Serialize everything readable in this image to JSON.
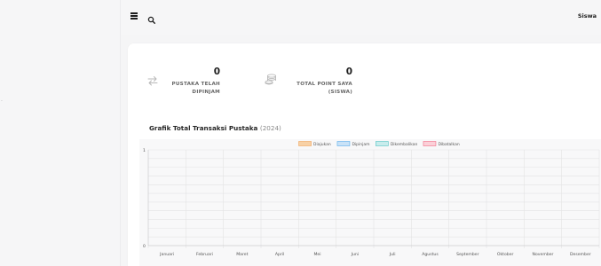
{
  "topbar": {
    "user_name": "Siswa"
  },
  "stats": [
    {
      "value": "0",
      "label_lines": [
        "PUSTAKA TELAH",
        "DIPINJAM"
      ],
      "icon": "swap-arrows-icon"
    },
    {
      "value": "0",
      "label_lines": [
        "TOTAL POINT SAYA",
        "(SISWA)"
      ],
      "icon": "coins-stack-icon"
    }
  ],
  "chart": {
    "title": "Grafik Total Transaksi Pustaka",
    "year": "(2024)"
  },
  "chart_data": {
    "type": "bar",
    "categories": [
      "Januari",
      "Februari",
      "Maret",
      "April",
      "Mei",
      "Juni",
      "Juli",
      "Agustus",
      "September",
      "Oktober",
      "November",
      "Desember"
    ],
    "series": [
      {
        "name": "Diajukan",
        "color": "#f7d1a6",
        "border": "#f0a35a",
        "values": [
          0,
          0,
          0,
          0,
          0,
          0,
          0,
          0,
          0,
          0,
          0,
          0
        ]
      },
      {
        "name": "Dipinjam",
        "color": "#c9e2f7",
        "border": "#5aaeea",
        "values": [
          0,
          0,
          0,
          0,
          0,
          0,
          0,
          0,
          0,
          0,
          0,
          0
        ]
      },
      {
        "name": "Dikembalikan",
        "color": "#c8ecec",
        "border": "#56c4c4",
        "values": [
          0,
          0,
          0,
          0,
          0,
          0,
          0,
          0,
          0,
          0,
          0,
          0
        ]
      },
      {
        "name": "Dibatalkan",
        "color": "#fbd0d8",
        "border": "#f26d86",
        "values": [
          0,
          0,
          0,
          0,
          0,
          0,
          0,
          0,
          0,
          0,
          0,
          0
        ]
      }
    ],
    "ylim": [
      0,
      1
    ],
    "y_ticks": [
      "1",
      "0"
    ],
    "grid": true,
    "legend": "top"
  }
}
